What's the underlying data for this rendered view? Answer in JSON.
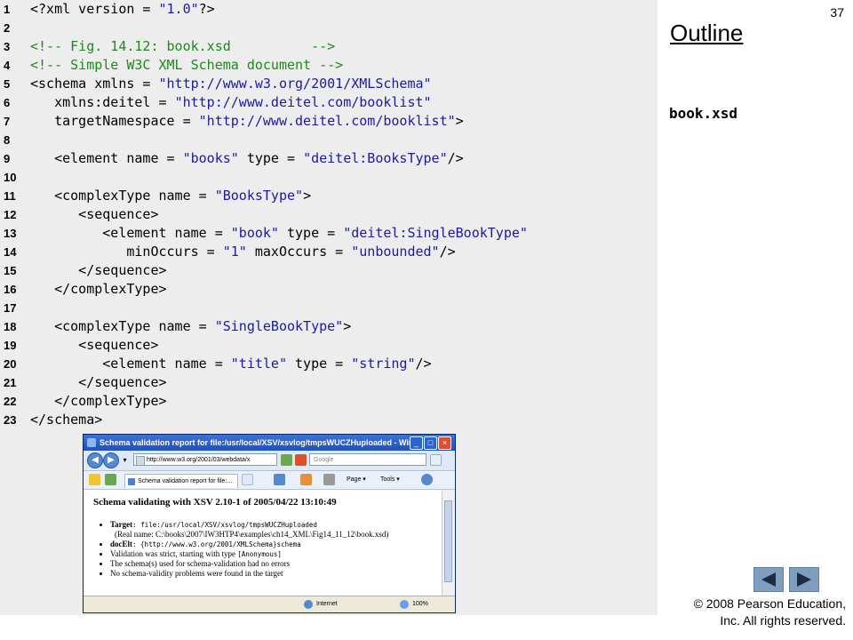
{
  "slide": {
    "number": "37",
    "outline_title": "Outline",
    "file_label": "book.xsd",
    "copyright_line1": "© 2008 Pearson Education,",
    "copyright_line2": "Inc.  All rights reserved."
  },
  "code_lines": [
    {
      "num": "1",
      "tokens": [
        [
          "t",
          "<?xml version = "
        ],
        [
          "s",
          "\"1.0\""
        ],
        [
          "t",
          "?>"
        ]
      ]
    },
    {
      "num": "2",
      "tokens": []
    },
    {
      "num": "3",
      "tokens": [
        [
          "c",
          "<!-- Fig. 14.12: book.xsd          -->"
        ]
      ]
    },
    {
      "num": "4",
      "tokens": [
        [
          "c",
          "<!-- Simple W3C XML Schema document -->"
        ]
      ]
    },
    {
      "num": "5",
      "tokens": [
        [
          "t",
          "<schema xmlns = "
        ],
        [
          "s",
          "\"http://www.w3.org/2001/XMLSchema\""
        ]
      ]
    },
    {
      "num": "6",
      "tokens": [
        [
          "t",
          "   xmlns:deitel = "
        ],
        [
          "s",
          "\"http://www.deitel.com/booklist\""
        ]
      ]
    },
    {
      "num": "7",
      "tokens": [
        [
          "t",
          "   targetNamespace = "
        ],
        [
          "s",
          "\"http://www.deitel.com/booklist\""
        ],
        [
          "t",
          ">"
        ]
      ]
    },
    {
      "num": "8",
      "tokens": []
    },
    {
      "num": "9",
      "tokens": [
        [
          "t",
          "   <element name = "
        ],
        [
          "s",
          "\"books\""
        ],
        [
          "t",
          " type = "
        ],
        [
          "s",
          "\"deitel:BooksType\""
        ],
        [
          "t",
          "/>"
        ]
      ]
    },
    {
      "num": "10",
      "tokens": []
    },
    {
      "num": "11",
      "tokens": [
        [
          "t",
          "   <complexType name = "
        ],
        [
          "s",
          "\"BooksType\""
        ],
        [
          "t",
          ">"
        ]
      ]
    },
    {
      "num": "12",
      "tokens": [
        [
          "t",
          "      <sequence>"
        ]
      ]
    },
    {
      "num": "13",
      "tokens": [
        [
          "t",
          "         <element name = "
        ],
        [
          "s",
          "\"book\""
        ],
        [
          "t",
          " type = "
        ],
        [
          "s",
          "\"deitel:SingleBookType\""
        ]
      ]
    },
    {
      "num": "14",
      "tokens": [
        [
          "t",
          "            minOccurs = "
        ],
        [
          "s",
          "\"1\""
        ],
        [
          "t",
          " maxOccurs = "
        ],
        [
          "s",
          "\"unbounded\""
        ],
        [
          "t",
          "/>"
        ]
      ]
    },
    {
      "num": "15",
      "tokens": [
        [
          "t",
          "      </sequence>"
        ]
      ]
    },
    {
      "num": "16",
      "tokens": [
        [
          "t",
          "   </complexType>"
        ]
      ]
    },
    {
      "num": "17",
      "tokens": []
    },
    {
      "num": "18",
      "tokens": [
        [
          "t",
          "   <complexType name = "
        ],
        [
          "s",
          "\"SingleBookType\""
        ],
        [
          "t",
          ">"
        ]
      ]
    },
    {
      "num": "19",
      "tokens": [
        [
          "t",
          "      <sequence>"
        ]
      ]
    },
    {
      "num": "20",
      "tokens": [
        [
          "t",
          "         <element name = "
        ],
        [
          "s",
          "\"title\""
        ],
        [
          "t",
          " type = "
        ],
        [
          "s",
          "\"string\""
        ],
        [
          "t",
          "/>"
        ]
      ]
    },
    {
      "num": "21",
      "tokens": [
        [
          "t",
          "      </sequence>"
        ]
      ]
    },
    {
      "num": "22",
      "tokens": [
        [
          "t",
          "   </complexType>"
        ]
      ]
    },
    {
      "num": "23",
      "tokens": [
        [
          "t",
          "</schema>"
        ]
      ]
    }
  ],
  "browser": {
    "window_title": "Schema validation report for file:/usr/local/XSV/xsvlog/tmpsWUCZHuploaded - Win...",
    "address": "http://www.w3.org/2001/03/webdata/x",
    "search_placeholder": "Google",
    "tab_label": "Schema validation report for file:...",
    "cmd_page": "Page",
    "cmd_tools": "Tools",
    "heading": "Schema validating with XSV 2.10-1 of 2005/04/22 13:10:49",
    "target_label": "Target",
    "target_value": ": file:/usr/local/XSV/xsvlog/tmpsWUCZHuploaded",
    "target_realname": "(Real name: C:\\books\\2007\\IW3HTP4\\examples\\ch14_XML\\Fig14_11_12\\book.xsd)",
    "docelt_label": "docElt",
    "docelt_value": ": {http://www.w3.org/2001/XMLSchema}schema",
    "validation_text": "Validation was strict, starting with type ",
    "validation_type": "[Anonymous]",
    "schemas_text": "The schema(s) used for schema-validation had no errors",
    "no_problems_text": "No schema-validity problems were found in the target",
    "status_zone": "Internet",
    "status_zoom": "100%"
  },
  "colors": {
    "code_bg": "#ededed",
    "string": "#1a1aa6",
    "comment": "#1b8a1b",
    "nav_button": "#7f9dbf"
  }
}
